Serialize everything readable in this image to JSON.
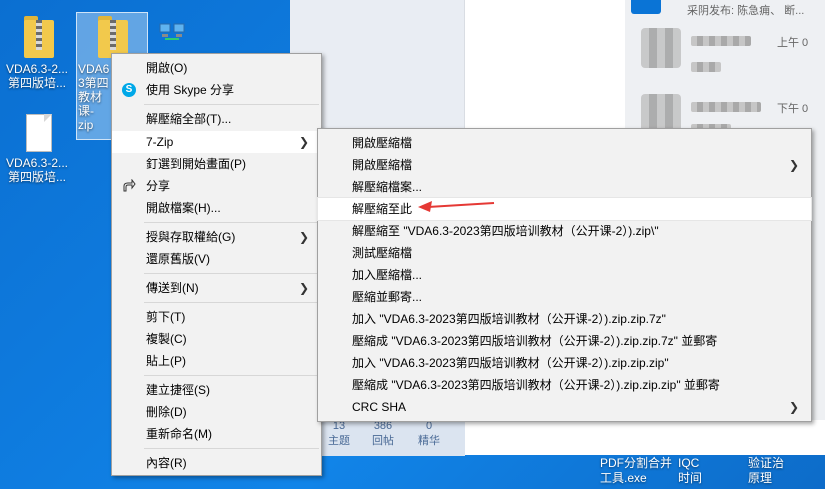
{
  "desktop": {
    "icons": [
      {
        "label": "VDA6.3-2...\n第四版培..."
      },
      {
        "label": "VDA6\n3第四\n教材\n课-\nzip"
      },
      {
        "label": "VDA6.3-2...\n第四版培..."
      }
    ]
  },
  "background": {
    "chat": {
      "header_text": "采阴发布: 陈急痈、 断...",
      "time1": "上午 0",
      "time2": "下午 0"
    },
    "stats": [
      {
        "value": "13",
        "label": "主题"
      },
      {
        "value": "386",
        "label": "回帖"
      },
      {
        "value": "0",
        "label": "精华"
      }
    ],
    "taskbar": {
      "pdf_tool": "PDF分割合并\n工具.exe",
      "iqc": "IQC\n时间",
      "right": "验证治\n原理"
    }
  },
  "context_menu": {
    "items": [
      {
        "label": "開啟(O)"
      },
      {
        "label": "使用 Skype 分享",
        "icon": "skype-icon"
      },
      {
        "label": "解壓縮全部(T)..."
      },
      {
        "label": "7-Zip",
        "has_submenu": true
      },
      {
        "label": "釘選到開始畫面(P)"
      },
      {
        "label": "分享",
        "icon": "share-icon"
      },
      {
        "label": "開啟檔案(H)..."
      },
      {
        "label": "授與存取權給(G)",
        "has_submenu": true
      },
      {
        "label": "還原舊版(V)"
      },
      {
        "label": "傳送到(N)",
        "has_submenu": true
      },
      {
        "label": "剪下(T)"
      },
      {
        "label": "複製(C)"
      },
      {
        "label": "貼上(P)"
      },
      {
        "label": "建立捷徑(S)"
      },
      {
        "label": "刪除(D)"
      },
      {
        "label": "重新命名(M)"
      },
      {
        "label": "內容(R)"
      }
    ],
    "submenu_arrow": ">"
  },
  "zip_submenu": {
    "items": [
      {
        "label": "開啟壓縮檔"
      },
      {
        "label": "開啟壓縮檔",
        "has_submenu": true
      },
      {
        "label": "解壓縮檔案..."
      },
      {
        "label": "解壓縮至此"
      },
      {
        "label": "解壓縮至 \"VDA6.3-2023第四版培训教材（公开课-2）).zip\\\""
      },
      {
        "label": "測試壓縮檔"
      },
      {
        "label": "加入壓縮檔..."
      },
      {
        "label": "壓縮並郵寄..."
      },
      {
        "label": "加入 \"VDA6.3-2023第四版培训教材（公开课-2）).zip.zip.7z\""
      },
      {
        "label": "壓縮成 \"VDA6.3-2023第四版培训教材（公开课-2）).zip.zip.7z\" 並郵寄"
      },
      {
        "label": "加入 \"VDA6.3-2023第四版培训教材（公开课-2）).zip.zip.zip\""
      },
      {
        "label": "壓縮成 \"VDA6.3-2023第四版培训教材（公开课-2）).zip.zip.zip\" 並郵寄"
      },
      {
        "label": "CRC SHA",
        "has_submenu": true
      }
    ]
  },
  "colors": {
    "desktop": "#0b6fd1",
    "menu_bg": "#f2f2f2",
    "annotation_arrow": "#e53935"
  }
}
